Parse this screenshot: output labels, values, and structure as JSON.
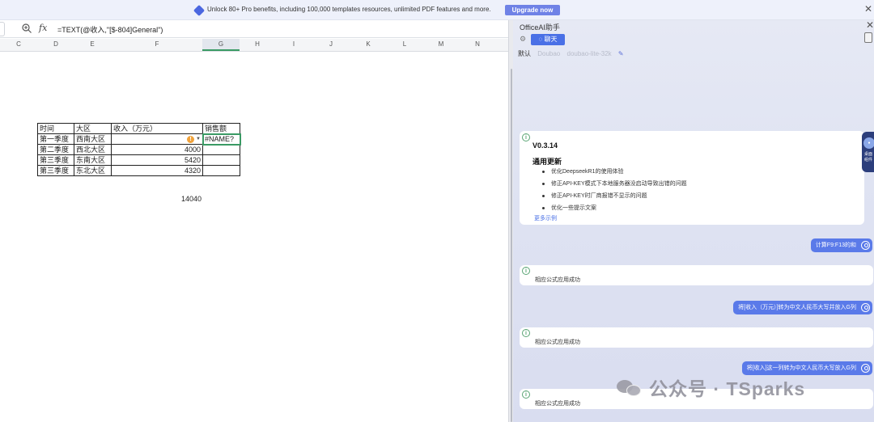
{
  "banner": {
    "text": "Unlock 80+ Pro benefits, including 100,000 templates resources, unlimited PDF features and more.",
    "button": "Upgrade now",
    "close_icon": "close-icon",
    "accent": "#6f82e6"
  },
  "sheet": {
    "formula": "=TEXT(@收入,\"[$-804]General\")",
    "columns": [
      "C",
      "D",
      "E",
      "F",
      "G",
      "H",
      "I",
      "J",
      "K",
      "L",
      "M",
      "N"
    ],
    "selected_column": "G",
    "table": {
      "headers": [
        "时间",
        "大区",
        "收入（万元）",
        "销售额"
      ],
      "rows": [
        [
          "第一季度",
          "西南大区",
          "",
          "#NAME?"
        ],
        [
          "第二季度",
          "西北大区",
          "4000",
          ""
        ],
        [
          "第三季度",
          "东南大区",
          "5420",
          ""
        ],
        [
          "第三季度",
          "东北大区",
          "4320",
          ""
        ]
      ],
      "total": "14040"
    },
    "warning_icon": "warning-icon"
  },
  "panel": {
    "title": "OfficeAI助手",
    "tab_chat": "聊天",
    "models": [
      "默认",
      "Doubao",
      "doubao-lite-32k"
    ],
    "accent": "#4a70e6",
    "release": {
      "version": "V0.3.14",
      "heading": "通用更新",
      "notes": [
        "优化DeepseekR1的使用体验",
        "修正API-KEY模式下本地服务器没启动导致出错的问题",
        "修正API-KEY时厂商报错不显示的问题",
        "优化一些提示文案"
      ],
      "more": "更多示例"
    },
    "messages": [
      {
        "role": "user",
        "text": "计算F9:F13的和"
      },
      {
        "role": "assistant",
        "text": "相应公式应用成功"
      },
      {
        "role": "user",
        "text": "将[收入（万元）]转为中文人民币大写并放入G列"
      },
      {
        "role": "assistant",
        "text": "相应公式应用成功"
      },
      {
        "role": "user",
        "text": "将[收入]这一列转为中文人民币大写放入G列"
      },
      {
        "role": "assistant",
        "text": "相应公式应用成功"
      }
    ],
    "float_widget": {
      "label": "桌面组件"
    }
  },
  "watermark": {
    "text": "公众号 · TSparks"
  }
}
